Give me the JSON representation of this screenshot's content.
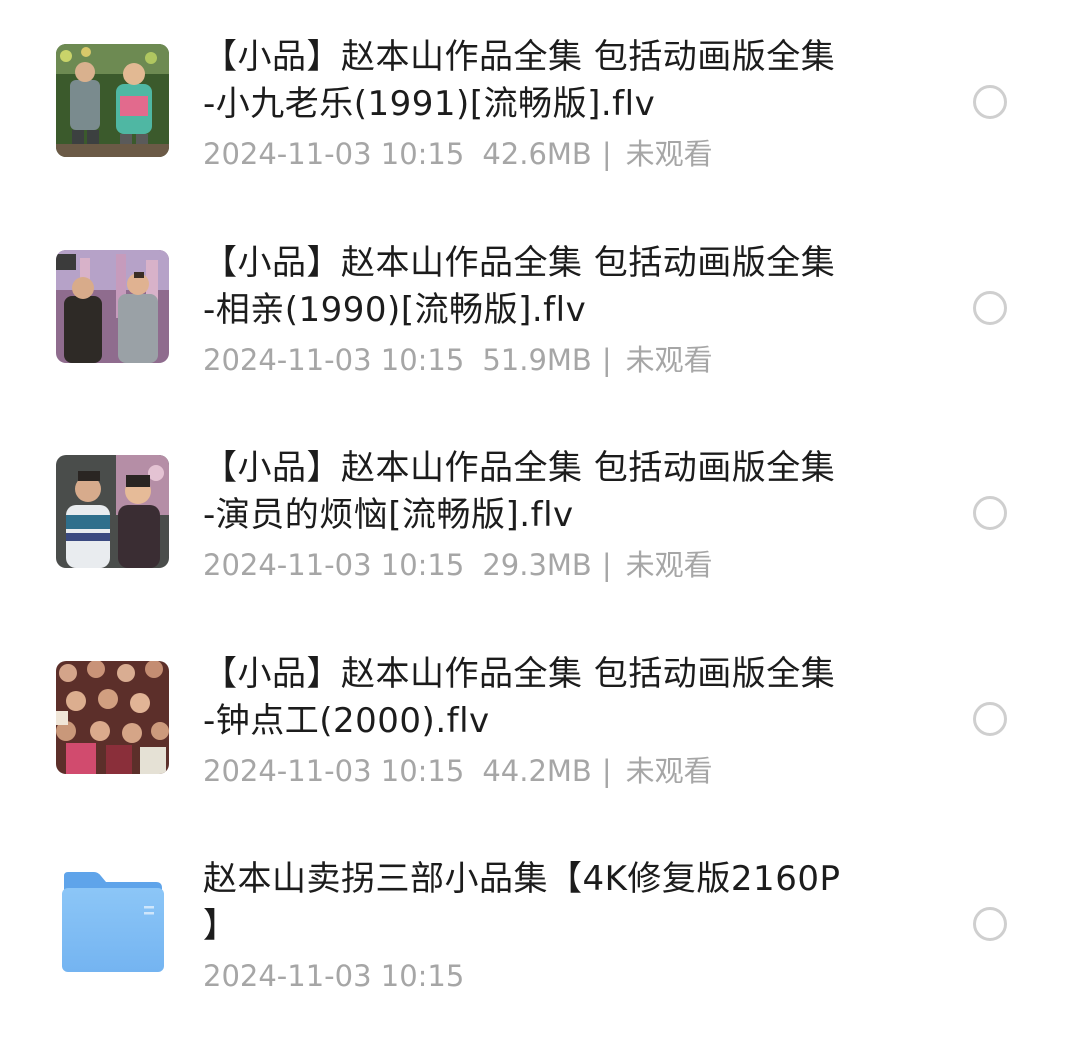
{
  "files": [
    {
      "thumb_icon": "video-thumbnail",
      "title_line1": "【小品】赵本山作品全集 包括动画版全集",
      "title_line2": "-小九老乐(1991)[流畅版].flv",
      "date": "2024-11-03 10:15",
      "size": "42.6MB",
      "separator": "|",
      "status": "未观看"
    },
    {
      "thumb_icon": "video-thumbnail",
      "title_line1": "【小品】赵本山作品全集 包括动画版全集",
      "title_line2": "-相亲(1990)[流畅版].flv",
      "date": "2024-11-03 10:15",
      "size": "51.9MB",
      "separator": "|",
      "status": "未观看"
    },
    {
      "thumb_icon": "video-thumbnail",
      "title_line1": "【小品】赵本山作品全集 包括动画版全集",
      "title_line2": "-演员的烦恼[流畅版].flv",
      "date": "2024-11-03 10:15",
      "size": "29.3MB",
      "separator": "|",
      "status": "未观看"
    },
    {
      "thumb_icon": "video-thumbnail",
      "title_line1": "【小品】赵本山作品全集 包括动画版全集",
      "title_line2": "-钟点工(2000).flv",
      "date": "2024-11-03 10:15",
      "size": "44.2MB",
      "separator": "|",
      "status": "未观看"
    }
  ],
  "folder": {
    "icon": "folder-icon",
    "title_line1": "赵本山卖拐三部小品集【4K修复版2160P",
    "title_line2": "】",
    "date": "2024-11-03 10:15"
  },
  "colors": {
    "title": "#1c1c1c",
    "meta": "#a6a6a6",
    "radio": "#cfcfcf",
    "folder": "#7fbef5"
  }
}
